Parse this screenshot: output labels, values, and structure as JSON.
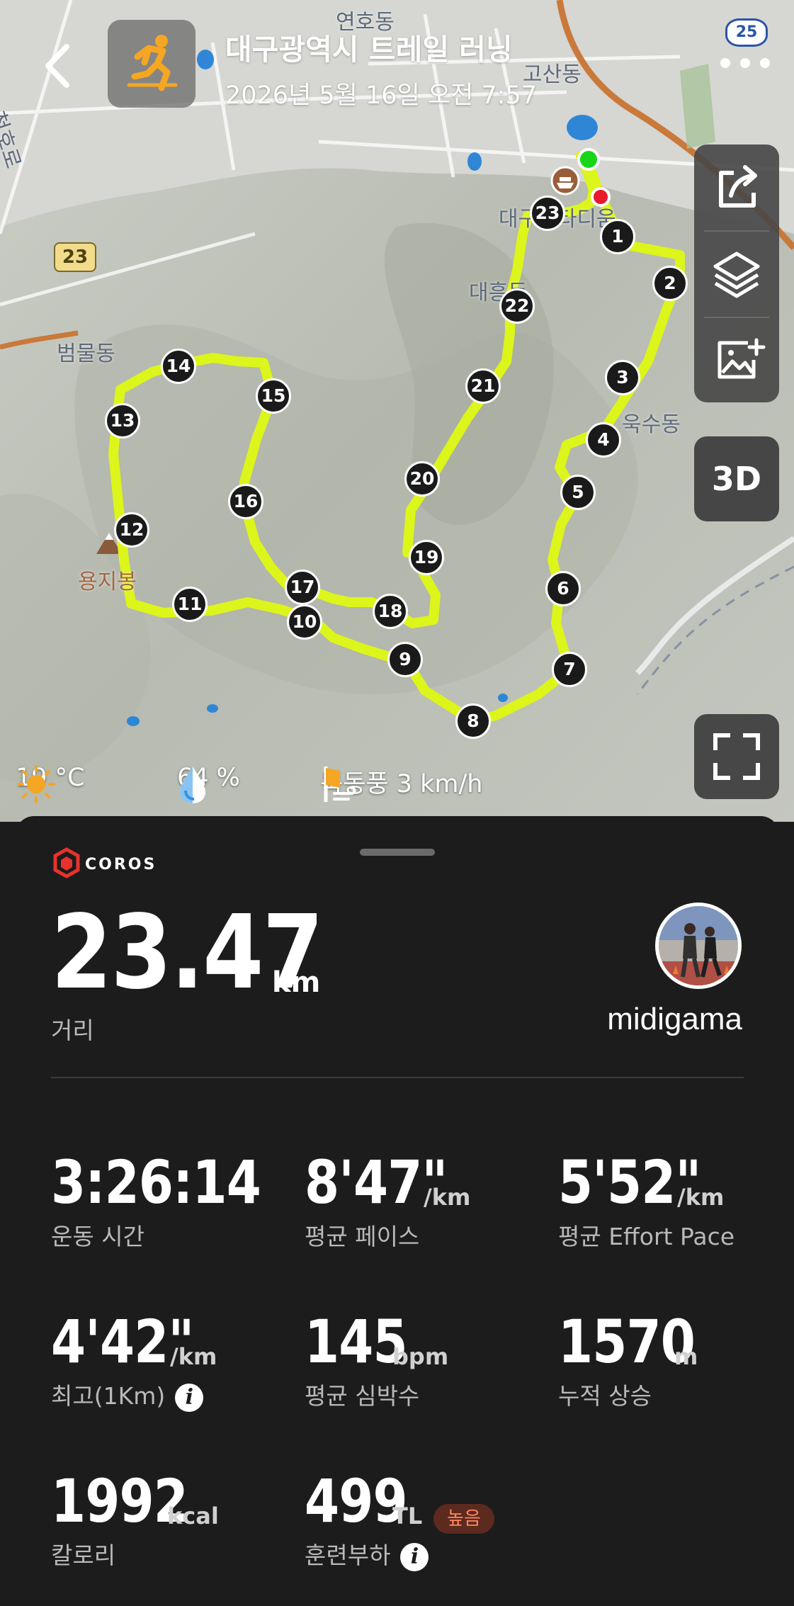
{
  "header": {
    "title": "대구광역시 트레일 러닝",
    "datetime": "2026년 5월 16일 오전 7:57",
    "badge": "25"
  },
  "map": {
    "labels": {
      "yeonho": "연호동",
      "gosan": "고산동",
      "cheongho": "청호로",
      "road_number": "23",
      "bummul": "범물동",
      "daeheung": "대흥동",
      "daegu_stadium": "대구스타디움",
      "uksu": "욱수동",
      "yongji": "용지봉",
      "edge_ro": "로"
    },
    "km_markers": [
      "1",
      "2",
      "3",
      "4",
      "5",
      "6",
      "7",
      "8",
      "9",
      "10",
      "11",
      "12",
      "13",
      "14",
      "15",
      "16",
      "17",
      "18",
      "19",
      "20",
      "21",
      "22",
      "23"
    ],
    "route_color": "#dcf51a",
    "start_color": "#17d617",
    "end_color": "#e8192c"
  },
  "controls": {
    "btn3d": "3D"
  },
  "weather": {
    "temperature": "19 °C",
    "humidity": "64 %",
    "wind": "북동풍 3 km/h"
  },
  "activity": {
    "distance": {
      "value": "23.47",
      "unit": "km",
      "label": "거리"
    },
    "username": "midigama",
    "stats": {
      "time": {
        "value": "3:26:14",
        "unit": "",
        "label": "운동 시간"
      },
      "pace": {
        "value": "8'47\"",
        "unit": "/km",
        "label": "평균 페이스"
      },
      "effort": {
        "value": "5'52\"",
        "unit": "/km",
        "label": "평균 Effort Pace"
      },
      "best": {
        "value": "4'42\"",
        "unit": "/km",
        "label": "최고(1Km)"
      },
      "hr": {
        "value": "145",
        "unit": "bpm",
        "label": "평균 심박수"
      },
      "ascent": {
        "value": "1570",
        "unit": "m",
        "label": "누적 상승"
      },
      "kcal": {
        "value": "1992",
        "unit": "kcal",
        "label": "칼로리"
      },
      "load": {
        "value": "499",
        "unit": "TL",
        "label": "훈련부하",
        "badge": "높음"
      }
    }
  },
  "brand": {
    "name": "COROS",
    "color": "#e8322b"
  }
}
